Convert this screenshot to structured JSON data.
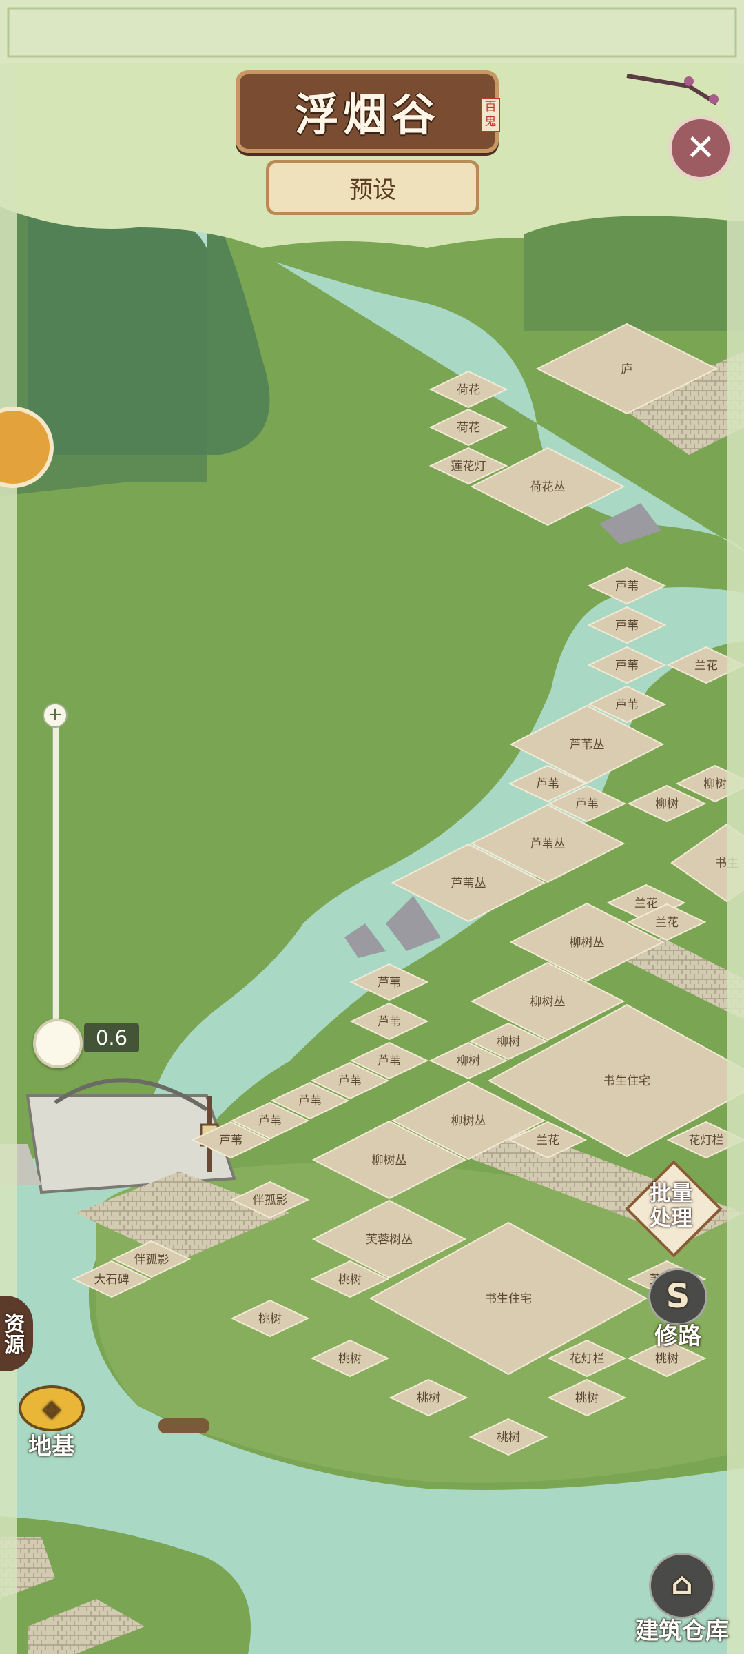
{
  "header": {
    "title": "浮烟谷",
    "seal": "百鬼",
    "preset_label": "预设",
    "close_icon": "close-icon"
  },
  "zoom": {
    "value_label": "0.6",
    "level": 0.6,
    "plus_icon": "plus-icon"
  },
  "sidebar": {
    "resources_label": "资源",
    "foundation_label": "地基",
    "foundation_icon": "foundation-icon",
    "batch_label_1": "批量",
    "batch_label_2": "处理",
    "road_label": "修路",
    "road_icon": "road-icon",
    "warehouse_label": "建筑仓库",
    "warehouse_icon": "building-icon"
  },
  "plots": [
    {
      "label": "庐"
    },
    {
      "label": "荷花"
    },
    {
      "label": "荷花"
    },
    {
      "label": "莲花灯"
    },
    {
      "label": "荷花丛"
    },
    {
      "label": "芦苇"
    },
    {
      "label": "芦苇"
    },
    {
      "label": "芦苇"
    },
    {
      "label": "芦苇"
    },
    {
      "label": "兰花"
    },
    {
      "label": "芦苇丛"
    },
    {
      "label": "芦苇"
    },
    {
      "label": "芦苇"
    },
    {
      "label": "柳树"
    },
    {
      "label": "柳树"
    },
    {
      "label": "芦苇丛"
    },
    {
      "label": "芦苇丛"
    },
    {
      "label": "书生"
    },
    {
      "label": "兰花"
    },
    {
      "label": "兰花"
    },
    {
      "label": "柳树丛"
    },
    {
      "label": "芦苇"
    },
    {
      "label": "芦苇"
    },
    {
      "label": "柳树丛"
    },
    {
      "label": "芦苇"
    },
    {
      "label": "柳树"
    },
    {
      "label": "柳树"
    },
    {
      "label": "芦苇"
    },
    {
      "label": "书生住宅"
    },
    {
      "label": "芦苇"
    },
    {
      "label": "芦苇"
    },
    {
      "label": "柳树丛"
    },
    {
      "label": "芦苇"
    },
    {
      "label": "兰花"
    },
    {
      "label": "花灯栏"
    },
    {
      "label": "柳树丛"
    },
    {
      "label": "伴孤影"
    },
    {
      "label": "芙蓉树丛"
    },
    {
      "label": "伴孤影"
    },
    {
      "label": "大石碑"
    },
    {
      "label": "桃树"
    },
    {
      "label": "芙蓉树"
    },
    {
      "label": "书生住宅"
    },
    {
      "label": "桃树"
    },
    {
      "label": "桃树"
    },
    {
      "label": "花灯栏"
    },
    {
      "label": "桃树"
    },
    {
      "label": "桃树"
    },
    {
      "label": "桃树"
    },
    {
      "label": "桃树"
    }
  ]
}
